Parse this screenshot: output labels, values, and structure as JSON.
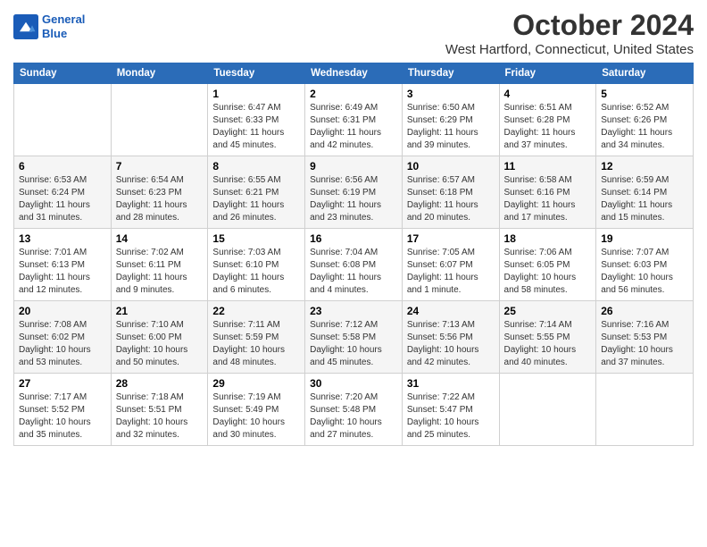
{
  "header": {
    "logo_line1": "General",
    "logo_line2": "Blue",
    "month": "October 2024",
    "location": "West Hartford, Connecticut, United States"
  },
  "weekdays": [
    "Sunday",
    "Monday",
    "Tuesday",
    "Wednesday",
    "Thursday",
    "Friday",
    "Saturday"
  ],
  "weeks": [
    [
      {
        "day": "",
        "sunrise": "",
        "sunset": "",
        "daylight": ""
      },
      {
        "day": "",
        "sunrise": "",
        "sunset": "",
        "daylight": ""
      },
      {
        "day": "1",
        "sunrise": "Sunrise: 6:47 AM",
        "sunset": "Sunset: 6:33 PM",
        "daylight": "Daylight: 11 hours and 45 minutes."
      },
      {
        "day": "2",
        "sunrise": "Sunrise: 6:49 AM",
        "sunset": "Sunset: 6:31 PM",
        "daylight": "Daylight: 11 hours and 42 minutes."
      },
      {
        "day": "3",
        "sunrise": "Sunrise: 6:50 AM",
        "sunset": "Sunset: 6:29 PM",
        "daylight": "Daylight: 11 hours and 39 minutes."
      },
      {
        "day": "4",
        "sunrise": "Sunrise: 6:51 AM",
        "sunset": "Sunset: 6:28 PM",
        "daylight": "Daylight: 11 hours and 37 minutes."
      },
      {
        "day": "5",
        "sunrise": "Sunrise: 6:52 AM",
        "sunset": "Sunset: 6:26 PM",
        "daylight": "Daylight: 11 hours and 34 minutes."
      }
    ],
    [
      {
        "day": "6",
        "sunrise": "Sunrise: 6:53 AM",
        "sunset": "Sunset: 6:24 PM",
        "daylight": "Daylight: 11 hours and 31 minutes."
      },
      {
        "day": "7",
        "sunrise": "Sunrise: 6:54 AM",
        "sunset": "Sunset: 6:23 PM",
        "daylight": "Daylight: 11 hours and 28 minutes."
      },
      {
        "day": "8",
        "sunrise": "Sunrise: 6:55 AM",
        "sunset": "Sunset: 6:21 PM",
        "daylight": "Daylight: 11 hours and 26 minutes."
      },
      {
        "day": "9",
        "sunrise": "Sunrise: 6:56 AM",
        "sunset": "Sunset: 6:19 PM",
        "daylight": "Daylight: 11 hours and 23 minutes."
      },
      {
        "day": "10",
        "sunrise": "Sunrise: 6:57 AM",
        "sunset": "Sunset: 6:18 PM",
        "daylight": "Daylight: 11 hours and 20 minutes."
      },
      {
        "day": "11",
        "sunrise": "Sunrise: 6:58 AM",
        "sunset": "Sunset: 6:16 PM",
        "daylight": "Daylight: 11 hours and 17 minutes."
      },
      {
        "day": "12",
        "sunrise": "Sunrise: 6:59 AM",
        "sunset": "Sunset: 6:14 PM",
        "daylight": "Daylight: 11 hours and 15 minutes."
      }
    ],
    [
      {
        "day": "13",
        "sunrise": "Sunrise: 7:01 AM",
        "sunset": "Sunset: 6:13 PM",
        "daylight": "Daylight: 11 hours and 12 minutes."
      },
      {
        "day": "14",
        "sunrise": "Sunrise: 7:02 AM",
        "sunset": "Sunset: 6:11 PM",
        "daylight": "Daylight: 11 hours and 9 minutes."
      },
      {
        "day": "15",
        "sunrise": "Sunrise: 7:03 AM",
        "sunset": "Sunset: 6:10 PM",
        "daylight": "Daylight: 11 hours and 6 minutes."
      },
      {
        "day": "16",
        "sunrise": "Sunrise: 7:04 AM",
        "sunset": "Sunset: 6:08 PM",
        "daylight": "Daylight: 11 hours and 4 minutes."
      },
      {
        "day": "17",
        "sunrise": "Sunrise: 7:05 AM",
        "sunset": "Sunset: 6:07 PM",
        "daylight": "Daylight: 11 hours and 1 minute."
      },
      {
        "day": "18",
        "sunrise": "Sunrise: 7:06 AM",
        "sunset": "Sunset: 6:05 PM",
        "daylight": "Daylight: 10 hours and 58 minutes."
      },
      {
        "day": "19",
        "sunrise": "Sunrise: 7:07 AM",
        "sunset": "Sunset: 6:03 PM",
        "daylight": "Daylight: 10 hours and 56 minutes."
      }
    ],
    [
      {
        "day": "20",
        "sunrise": "Sunrise: 7:08 AM",
        "sunset": "Sunset: 6:02 PM",
        "daylight": "Daylight: 10 hours and 53 minutes."
      },
      {
        "day": "21",
        "sunrise": "Sunrise: 7:10 AM",
        "sunset": "Sunset: 6:00 PM",
        "daylight": "Daylight: 10 hours and 50 minutes."
      },
      {
        "day": "22",
        "sunrise": "Sunrise: 7:11 AM",
        "sunset": "Sunset: 5:59 PM",
        "daylight": "Daylight: 10 hours and 48 minutes."
      },
      {
        "day": "23",
        "sunrise": "Sunrise: 7:12 AM",
        "sunset": "Sunset: 5:58 PM",
        "daylight": "Daylight: 10 hours and 45 minutes."
      },
      {
        "day": "24",
        "sunrise": "Sunrise: 7:13 AM",
        "sunset": "Sunset: 5:56 PM",
        "daylight": "Daylight: 10 hours and 42 minutes."
      },
      {
        "day": "25",
        "sunrise": "Sunrise: 7:14 AM",
        "sunset": "Sunset: 5:55 PM",
        "daylight": "Daylight: 10 hours and 40 minutes."
      },
      {
        "day": "26",
        "sunrise": "Sunrise: 7:16 AM",
        "sunset": "Sunset: 5:53 PM",
        "daylight": "Daylight: 10 hours and 37 minutes."
      }
    ],
    [
      {
        "day": "27",
        "sunrise": "Sunrise: 7:17 AM",
        "sunset": "Sunset: 5:52 PM",
        "daylight": "Daylight: 10 hours and 35 minutes."
      },
      {
        "day": "28",
        "sunrise": "Sunrise: 7:18 AM",
        "sunset": "Sunset: 5:51 PM",
        "daylight": "Daylight: 10 hours and 32 minutes."
      },
      {
        "day": "29",
        "sunrise": "Sunrise: 7:19 AM",
        "sunset": "Sunset: 5:49 PM",
        "daylight": "Daylight: 10 hours and 30 minutes."
      },
      {
        "day": "30",
        "sunrise": "Sunrise: 7:20 AM",
        "sunset": "Sunset: 5:48 PM",
        "daylight": "Daylight: 10 hours and 27 minutes."
      },
      {
        "day": "31",
        "sunrise": "Sunrise: 7:22 AM",
        "sunset": "Sunset: 5:47 PM",
        "daylight": "Daylight: 10 hours and 25 minutes."
      },
      {
        "day": "",
        "sunrise": "",
        "sunset": "",
        "daylight": ""
      },
      {
        "day": "",
        "sunrise": "",
        "sunset": "",
        "daylight": ""
      }
    ]
  ]
}
